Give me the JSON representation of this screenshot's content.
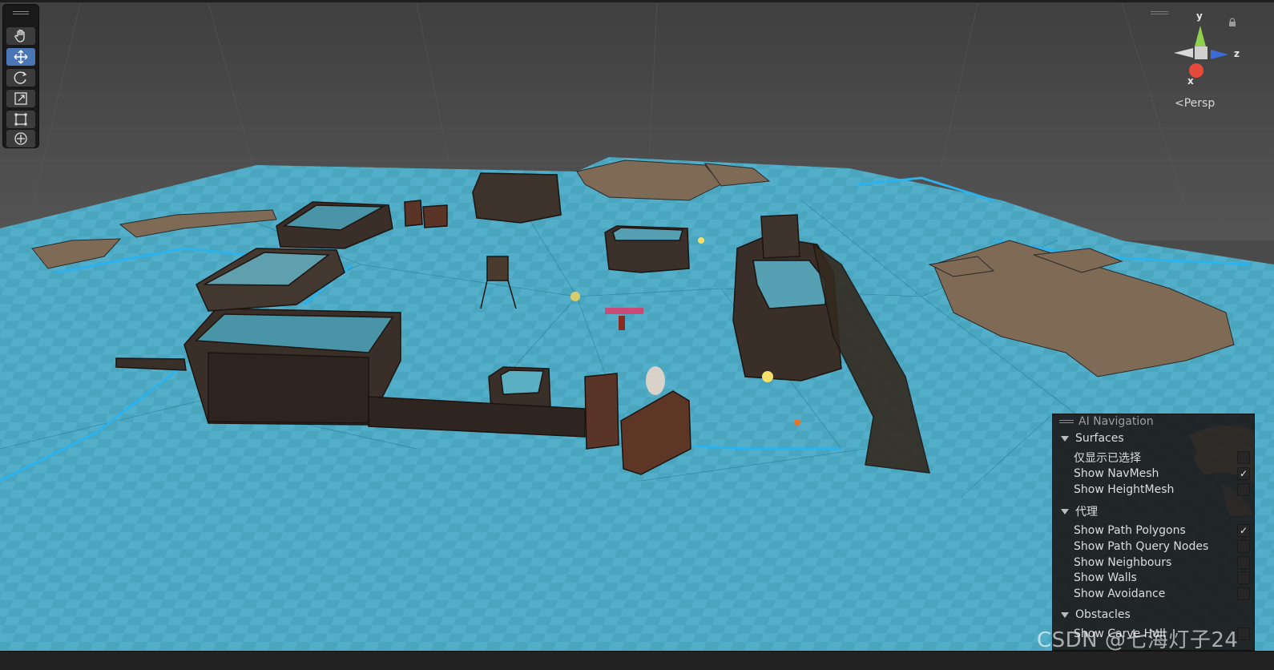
{
  "scene": {
    "camera_mode": "Persp",
    "colors": {
      "sky": "#4a4a4a",
      "navmesh": "#4fa6bf",
      "navmesh_dark": "#3b8aa2",
      "edge_highlight": "#2bb3f0",
      "terrain": "#7e6a55",
      "building": "#3a2f28",
      "roof": "#5a9cad"
    }
  },
  "toolbar": {
    "tools": [
      {
        "name": "hand-tool",
        "icon": "hand-icon",
        "active": false
      },
      {
        "name": "move-tool",
        "icon": "move-icon",
        "active": true
      },
      {
        "name": "rotate-tool",
        "icon": "rotate-icon",
        "active": false
      },
      {
        "name": "scale-tool",
        "icon": "scale-icon",
        "active": false
      },
      {
        "name": "rect-tool",
        "icon": "rect-transform-icon",
        "active": false
      },
      {
        "name": "transform-tool",
        "icon": "transform-icon",
        "active": false
      }
    ]
  },
  "gizmo": {
    "y_label": "y",
    "z_label": "z",
    "x_label": "x",
    "persp_label": "Persp",
    "colors": {
      "y": "#8fd14f",
      "z": "#3c6cd8",
      "x": "#e64a3a"
    }
  },
  "ai_navigation": {
    "title": "AI Navigation",
    "surfaces": {
      "header": "Surfaces",
      "options": [
        {
          "label": "仅显示已选择",
          "checked": false
        },
        {
          "label": "Show NavMesh",
          "checked": true
        },
        {
          "label": "Show HeightMesh",
          "checked": false
        }
      ]
    },
    "agents": {
      "header": "代理",
      "options": [
        {
          "label": "Show Path Polygons",
          "checked": true
        },
        {
          "label": "Show Path Query Nodes",
          "checked": false
        },
        {
          "label": "Show Neighbours",
          "checked": false
        },
        {
          "label": "Show Walls",
          "checked": false
        },
        {
          "label": "Show Avoidance",
          "checked": false
        }
      ]
    },
    "obstacles": {
      "header": "Obstacles",
      "options": [
        {
          "label": "Show Carve Hull",
          "checked": false
        }
      ]
    }
  },
  "watermark": "CSDN @七海灯子24",
  "checkmark_glyph": "✓"
}
